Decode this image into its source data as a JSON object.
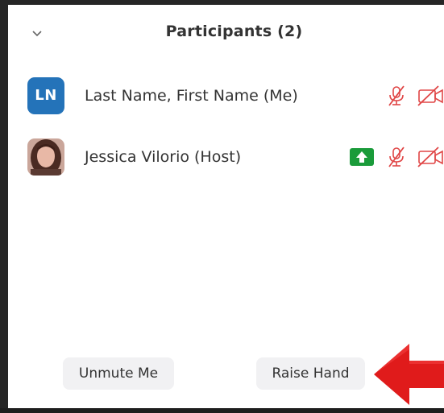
{
  "header": {
    "title": "Participants (2)",
    "collapse_icon": "chevron-down-icon"
  },
  "participants": [
    {
      "name": "Last Name, First Name (Me)",
      "avatar_initials": "LN",
      "avatar_color": "#2473b9",
      "audio": "muted",
      "video": "off"
    },
    {
      "name": "Jessica Vilorio (Host)",
      "avatar_initials": "",
      "avatar_type": "photo",
      "screen_share": true,
      "screen_share_color": "#1a9b3a",
      "audio": "muted",
      "video": "off"
    }
  ],
  "footer": {
    "unmute_label": "Unmute Me",
    "raise_hand_label": "Raise Hand"
  },
  "colors": {
    "muted_red": "#e04646",
    "annotation_arrow": "#e01b1b"
  }
}
